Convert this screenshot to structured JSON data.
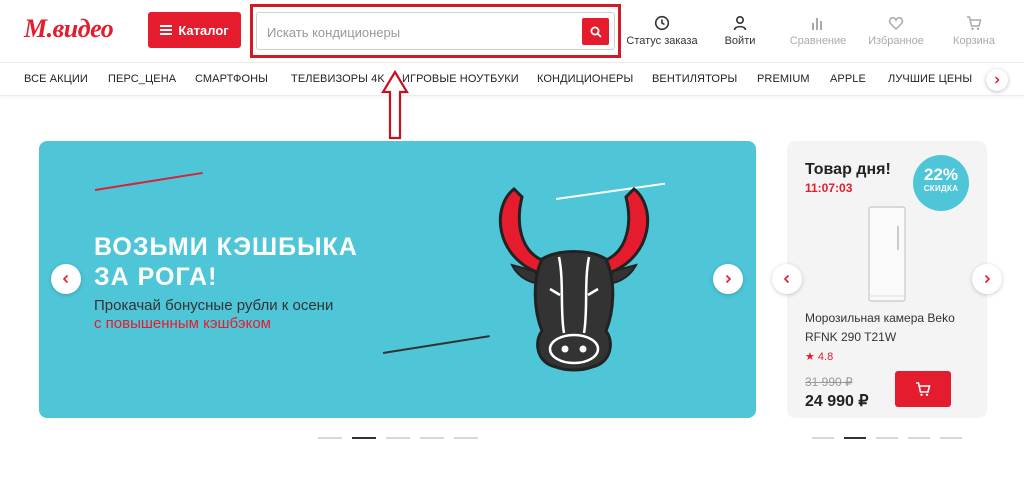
{
  "header": {
    "logo_text": "М.видео",
    "catalog_label": "Каталог",
    "search_placeholder": "Искать кондиционеры",
    "items": [
      {
        "label": "Статус заказа",
        "icon": "clock-icon"
      },
      {
        "label": "Войти",
        "icon": "user-icon"
      },
      {
        "label": "Сравнение",
        "icon": "compare-icon"
      },
      {
        "label": "Избранное",
        "icon": "heart-icon"
      },
      {
        "label": "Корзина",
        "icon": "cart-icon"
      }
    ]
  },
  "nav": {
    "items": [
      "ВСЕ АКЦИИ",
      "ПЕРС_ЦЕНА",
      "СМАРТФОНЫ",
      "ТЕЛЕВИЗОРЫ 4K",
      "ИГРОВЫЕ НОУТБУКИ",
      "КОНДИЦИОНЕРЫ",
      "ВЕНТИЛЯТОРЫ",
      "PREMIUM",
      "APPLE",
      "ЛУЧШИЕ ЦЕНЫ"
    ]
  },
  "banner": {
    "title": "ВОЗЬМИ КЭШБЫКА\nЗА РОГА!",
    "subtitle_line1": "Прокачай бонусные рубли к осени",
    "subtitle_line2": "с повышенным кэшбэком",
    "slides_count": 5,
    "active_slide": 2,
    "colors": {
      "background": "#4ec6d8",
      "accent": "#e41c2e",
      "dark": "#333333"
    }
  },
  "deal": {
    "title": "Товар дня!",
    "timer": "11:07:03",
    "discount_pct": "22%",
    "discount_label": "СКИДКА",
    "product_name": "Морозильная камера Beko RFNK 290 T21W",
    "rating": "★ 4.8",
    "old_price": "31 990 ₽",
    "new_price": "24 990 ₽",
    "slides_count": 5,
    "active_slide": 2
  },
  "brand_color": "#e41c2e"
}
